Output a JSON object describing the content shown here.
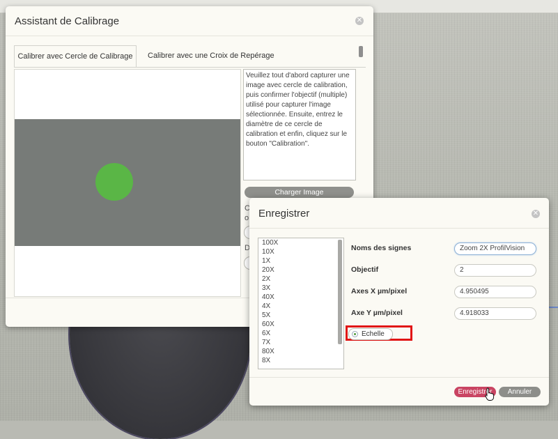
{
  "calibration_dialog": {
    "title": "Assistant de Calibrage",
    "close_glyph": "✕",
    "tabs": [
      {
        "label": "Calibrer avec Cercle de Calibrage"
      },
      {
        "label": "Calibrer avec une Croix de Repérage"
      }
    ],
    "instructions": "Veuillez tout d'abord capturer une image avec cercle de calibration, puis confirmer l'objectif (multiple) utilisé pour capturer l'image sélectionnée. Ensuite, entrez le diamètre de ce cercle de calibration et enfin, cliquez sur le bouton \"Calibration\".",
    "load_button": "Charger Image",
    "partial_labels": [
      "C",
      "o",
      "D"
    ]
  },
  "save_dialog": {
    "title": "Enregistrer",
    "close_glyph": "✕",
    "objective_list": [
      "100X",
      "10X",
      "1X",
      "20X",
      "2X",
      "3X",
      "40X",
      "4X",
      "5X",
      "60X",
      "6X",
      "7X",
      "80X",
      "8X"
    ],
    "fields": {
      "signs_name": {
        "label": "Noms des signes",
        "value": "Zoom 2X ProfilVision"
      },
      "objective": {
        "label": "Objectif",
        "value": "2"
      },
      "axis_x": {
        "label": "Axes X µm/pixel",
        "value": "4.950495"
      },
      "axis_y": {
        "label": "Axe Y µm/pixel",
        "value": "4.918033"
      }
    },
    "scale_radio": {
      "label": "Echelle",
      "checked": true
    },
    "buttons": {
      "save": "Enregistrer",
      "cancel": "Annuler"
    }
  },
  "colors": {
    "save_button": "#c94462",
    "cancel_button": "#8d8e8a",
    "highlight_box": "#e11515",
    "calibration_circle": "#5ab646"
  }
}
